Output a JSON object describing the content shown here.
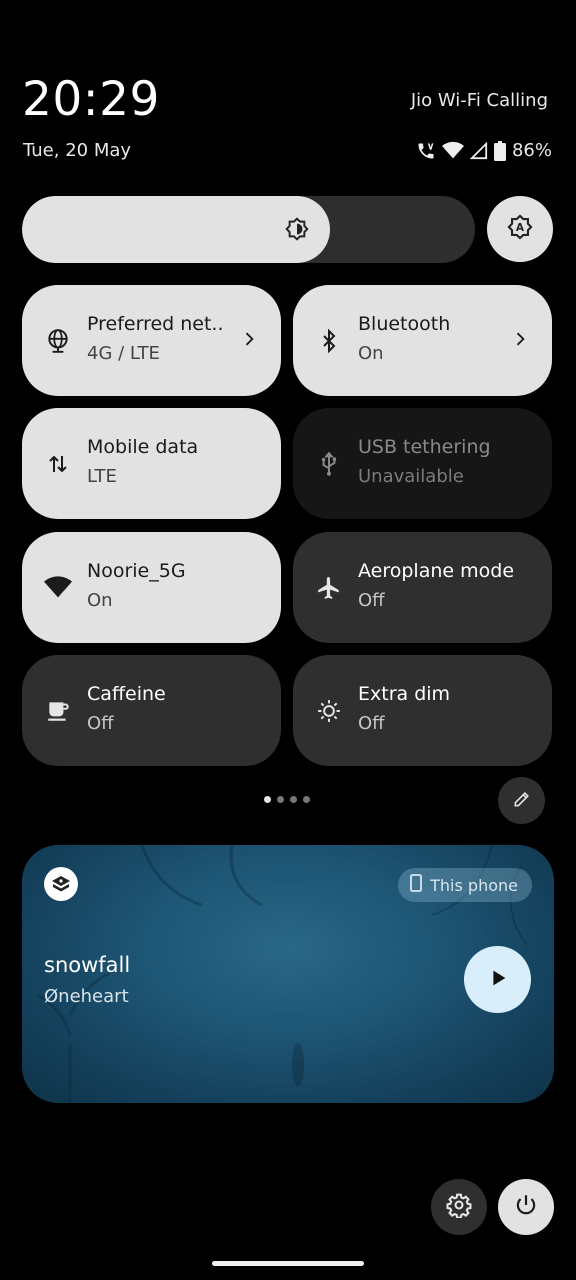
{
  "header": {
    "time": "20:29",
    "date": "Tue, 20 May",
    "carrier": "Jio Wi-Fi Calling",
    "battery": "86%"
  },
  "status_icons": [
    "wifi-calling-icon",
    "wifi-icon",
    "signal-icon",
    "battery-icon"
  ],
  "brightness": {
    "level": 0.68,
    "auto_icon": "auto-brightness-icon"
  },
  "tiles": [
    {
      "label": "Preferred net..",
      "sub": "4G / LTE",
      "state": "on",
      "icon": "globe-icon",
      "chevron": true
    },
    {
      "label": "Bluetooth",
      "sub": "On",
      "state": "on",
      "icon": "bluetooth-icon",
      "chevron": true
    },
    {
      "label": "Mobile data",
      "sub": "LTE",
      "state": "on",
      "icon": "data-arrows-icon"
    },
    {
      "label": "USB tethering",
      "sub": "Unavailable",
      "state": "unavailable",
      "icon": "usb-icon"
    },
    {
      "label": "Noorie_5G",
      "sub": "On",
      "state": "on",
      "icon": "wifi-icon"
    },
    {
      "label": "Aeroplane mode",
      "sub": "Off",
      "state": "off",
      "icon": "airplane-icon"
    },
    {
      "label": "Caffeine",
      "sub": "Off",
      "state": "off",
      "icon": "cup-icon"
    },
    {
      "label": "Extra dim",
      "sub": "Off",
      "state": "off",
      "icon": "extra-dim-icon"
    }
  ],
  "pager": {
    "pages": 4,
    "current": 1
  },
  "media": {
    "title": "snowfall",
    "artist": "Øneheart",
    "output": "This phone"
  },
  "colors": {
    "tile_on": "#e2e2e2",
    "tile_off": "#2f2f2f",
    "tile_unavailable": "#161616",
    "media_bg": "#1d5574",
    "play_button": "#d8eefa"
  }
}
